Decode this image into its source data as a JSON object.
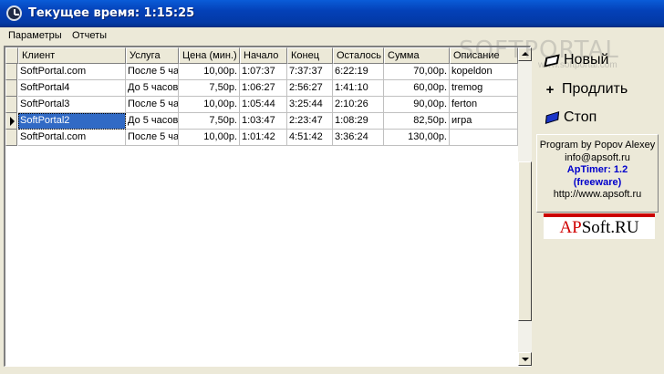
{
  "window": {
    "title": "Текущее время: 1:15:25",
    "icon": "clock-icon"
  },
  "menu": {
    "items": [
      "Параметры",
      "Отчеты"
    ]
  },
  "grid": {
    "columns": [
      "Клиент",
      "Услуга",
      "Цена (мин.)",
      "Начало",
      "Конец",
      "Осталось",
      "Сумма",
      "Описание"
    ],
    "rows": [
      [
        "SoftPortal.com",
        "После 5 ча",
        "10,00р.",
        "1:07:37",
        "7:37:37",
        "6:22:19",
        "70,00р.",
        "kopeldon"
      ],
      [
        "SoftPortal4",
        "До 5 часов",
        "7,50р.",
        "1:06:27",
        "2:56:27",
        "1:41:10",
        "60,00р.",
        "tremog"
      ],
      [
        "SoftPortal3",
        "После 5 ча",
        "10,00р.",
        "1:05:44",
        "3:25:44",
        "2:10:26",
        "90,00р.",
        "ferton"
      ],
      [
        "SoftPortal2",
        "До 5 часов",
        "7,50р.",
        "1:03:47",
        "2:23:47",
        "1:08:29",
        "82,50р.",
        "игра"
      ],
      [
        "SoftPortal.com",
        "После 5 ча",
        "10,00р.",
        "1:01:42",
        "4:51:42",
        "3:36:24",
        "130,00р.",
        ""
      ]
    ],
    "selected_row": 3
  },
  "actions": {
    "new_label": "Новый",
    "extend_label": "Продлить",
    "stop_label": "Стоп"
  },
  "info": {
    "author": "Program by Popov Alexey",
    "email": "info@apsoft.ru",
    "version": "ApTimer: 1.2",
    "license": "(freeware)",
    "url": "http://www.apsoft.ru"
  },
  "logo": {
    "ap": "AP",
    "soft": "Soft.RU"
  },
  "watermark": {
    "text": "SOFTPORTAL",
    "sub": "www.softportal.com"
  },
  "colors": {
    "titlebar": "#0441b8",
    "selection": "#316ac5",
    "info_accent": "#0000cc",
    "logo_red": "#d00000"
  }
}
